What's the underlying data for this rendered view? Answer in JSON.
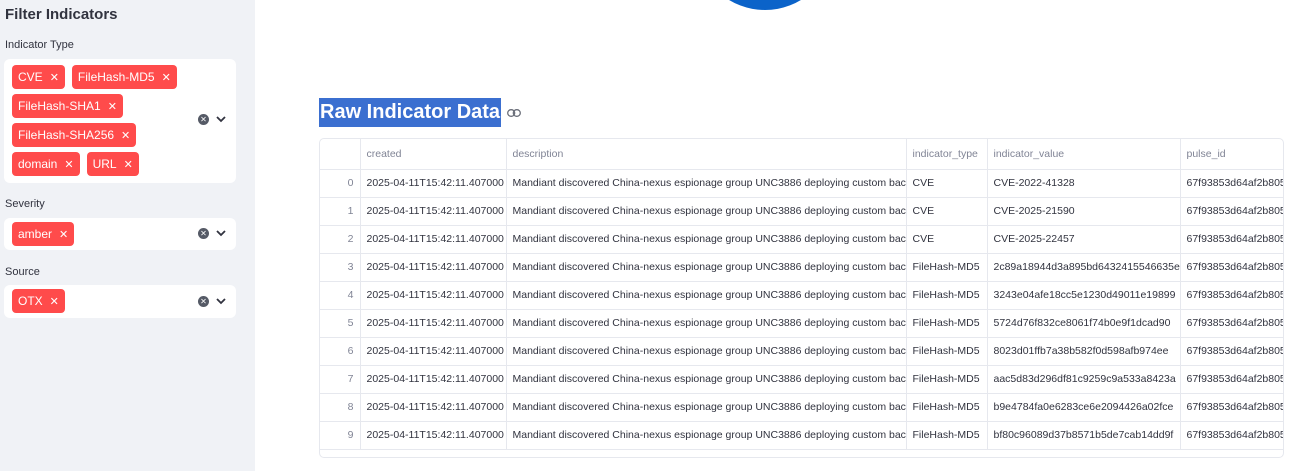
{
  "sidebar": {
    "title": "Filter Indicators",
    "indicator_type": {
      "label": "Indicator Type",
      "selected": [
        "CVE",
        "FileHash-MD5",
        "FileHash-SHA1",
        "FileHash-SHA256",
        "domain",
        "URL"
      ]
    },
    "severity": {
      "label": "Severity",
      "selected": [
        "amber"
      ]
    },
    "source": {
      "label": "Source",
      "selected": [
        "OTX"
      ]
    },
    "remove_glyph": "✕",
    "clear_glyph": "✕",
    "icons": {
      "clear": "clear-all-icon",
      "dropdown": "chevron-down-icon"
    }
  },
  "main": {
    "heading": "Raw Indicator Data",
    "heading_icon": "link-icon",
    "accent_colors": {
      "tag": "#ff4b4b",
      "selection": "#3b6fd0",
      "circle": "#0b63c9"
    },
    "table": {
      "columns": [
        "",
        "created",
        "description",
        "indicator_type",
        "indicator_value",
        "pulse_id"
      ],
      "rows": [
        [
          "0",
          "2025-04-11T15:42:11.407000",
          "Mandiant discovered China-nexus espionage group UNC3886 deploying custom back",
          "CVE",
          "CVE-2022-41328",
          "67f93853d64af2b805"
        ],
        [
          "1",
          "2025-04-11T15:42:11.407000",
          "Mandiant discovered China-nexus espionage group UNC3886 deploying custom back",
          "CVE",
          "CVE-2025-21590",
          "67f93853d64af2b805"
        ],
        [
          "2",
          "2025-04-11T15:42:11.407000",
          "Mandiant discovered China-nexus espionage group UNC3886 deploying custom back",
          "CVE",
          "CVE-2025-22457",
          "67f93853d64af2b805"
        ],
        [
          "3",
          "2025-04-11T15:42:11.407000",
          "Mandiant discovered China-nexus espionage group UNC3886 deploying custom back",
          "FileHash-MD5",
          "2c89a18944d3a895bd6432415546635e",
          "67f93853d64af2b805"
        ],
        [
          "4",
          "2025-04-11T15:42:11.407000",
          "Mandiant discovered China-nexus espionage group UNC3886 deploying custom back",
          "FileHash-MD5",
          "3243e04afe18cc5e1230d49011e19899",
          "67f93853d64af2b805"
        ],
        [
          "5",
          "2025-04-11T15:42:11.407000",
          "Mandiant discovered China-nexus espionage group UNC3886 deploying custom back",
          "FileHash-MD5",
          "5724d76f832ce8061f74b0e9f1dcad90",
          "67f93853d64af2b805"
        ],
        [
          "6",
          "2025-04-11T15:42:11.407000",
          "Mandiant discovered China-nexus espionage group UNC3886 deploying custom back",
          "FileHash-MD5",
          "8023d01ffb7a38b582f0d598afb974ee",
          "67f93853d64af2b805"
        ],
        [
          "7",
          "2025-04-11T15:42:11.407000",
          "Mandiant discovered China-nexus espionage group UNC3886 deploying custom back",
          "FileHash-MD5",
          "aac5d83d296df81c9259c9a533a8423a",
          "67f93853d64af2b805"
        ],
        [
          "8",
          "2025-04-11T15:42:11.407000",
          "Mandiant discovered China-nexus espionage group UNC3886 deploying custom back",
          "FileHash-MD5",
          "b9e4784fa0e6283ce6e2094426a02fce",
          "67f93853d64af2b805"
        ],
        [
          "9",
          "2025-04-11T15:42:11.407000",
          "Mandiant discovered China-nexus espionage group UNC3886 deploying custom back",
          "FileHash-MD5",
          "bf80c96089d37b8571b5de7cab14dd9f",
          "67f93853d64af2b805"
        ]
      ]
    }
  }
}
